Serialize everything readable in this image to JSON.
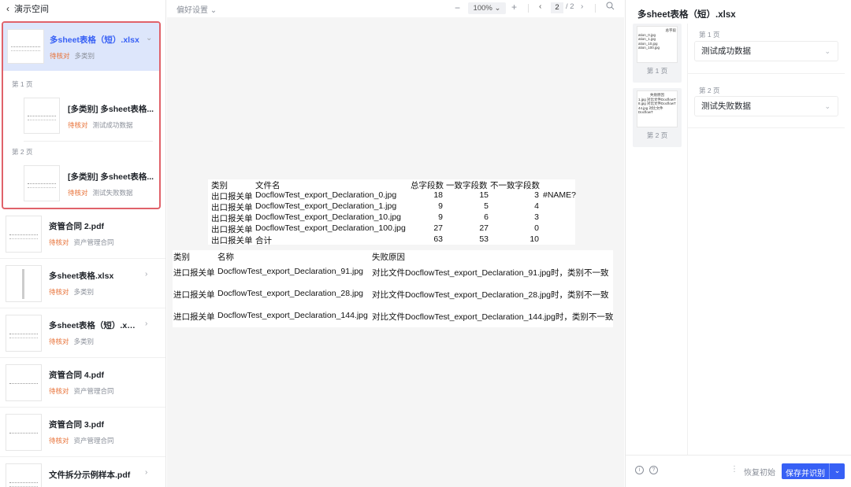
{
  "sidebar": {
    "header": {
      "back_icon": "chevron-left-icon",
      "title": "演示空间"
    },
    "selected": {
      "title": "多sheet表格（短）.xlsx",
      "status": "待核对",
      "category": "多类别",
      "pages": [
        {
          "label": "第 1 页",
          "title": "[多类别] 多sheet表格...",
          "status": "待核对",
          "category": "测试成功数据"
        },
        {
          "label": "第 2 页",
          "title": "[多类别] 多sheet表格...",
          "status": "待核对",
          "category": "测试失败数据"
        }
      ]
    },
    "items": [
      {
        "title": "资管合同 2.pdf",
        "status": "待核对",
        "category": "资产管理合同"
      },
      {
        "title": "多sheet表格.xlsx",
        "status": "待核对",
        "category": "多类别"
      },
      {
        "title": "多sheet表格（短）.xlsx",
        "status": "待核对",
        "category": "多类别"
      },
      {
        "title": "资管合同 4.pdf",
        "status": "待核对",
        "category": "资产管理合同"
      },
      {
        "title": "资管合同 3.pdf",
        "status": "待核对",
        "category": "资产管理合同"
      },
      {
        "title": "文件拆分示例样本.pdf",
        "status": "",
        "category": ""
      }
    ]
  },
  "toolbar": {
    "preferences": "偏好设置 ⌄",
    "zoom_out": "−",
    "zoom": "100% ⌄",
    "zoom_in": "+",
    "prev": "‹",
    "current_page": "2",
    "total_pages": "/ 2",
    "next": "›",
    "search_icon": "search-icon"
  },
  "sheet1": {
    "headers": [
      "类别",
      "文件名",
      "总字段数",
      "一致字段数",
      "不一致字段数"
    ],
    "rows": [
      [
        "出口报关单",
        "DocflowTest_export_Declaration_0.jpg",
        "18",
        "15",
        "3",
        "#NAME?"
      ],
      [
        "出口报关单",
        "DocflowTest_export_Declaration_1.jpg",
        "9",
        "5",
        "4",
        ""
      ],
      [
        "出口报关单",
        "DocflowTest_export_Declaration_10.jpg",
        "9",
        "6",
        "3",
        ""
      ],
      [
        "出口报关单",
        "DocflowTest_export_Declaration_100.jpg",
        "27",
        "27",
        "0",
        ""
      ],
      [
        "出口报关单",
        "合计",
        "63",
        "53",
        "10",
        ""
      ]
    ]
  },
  "sheet2": {
    "headers": [
      "类别",
      "名称",
      "失败原因"
    ],
    "rows": [
      [
        "进口报关单",
        "DocflowTest_export_Declaration_91.jpg",
        "对比文件DocflowTest_export_Declaration_91.jpg时，类别不一致"
      ],
      [
        "进口报关单",
        "DocflowTest_export_Declaration_28.jpg",
        "对比文件DocflowTest_export_Declaration_28.jpg时，类别不一致"
      ],
      [
        "进口报关单",
        "DocflowTest_export_Declaration_144.jpg",
        "对比文件DocflowTest_export_Declaration_144.jpg时，类别不一致"
      ]
    ]
  },
  "right": {
    "title": "多sheet表格（短）.xlsx",
    "thumbs": [
      {
        "label": "第 1 页",
        "lines": [
          "总字段",
          "ation_0.jpg",
          "ation_1.jpg",
          "ation_10.jpg",
          "ation_100.jpg"
        ]
      },
      {
        "label": "第 2 页",
        "lines": [
          "失败原因",
          "1.jpg 对比文件DocflowT",
          "8.jpg 对比文件DocflowT",
          "44.jpg 对比文件DocflowT"
        ]
      }
    ],
    "sections": [
      {
        "label": "第 1 页",
        "value": "测试成功数据"
      },
      {
        "label": "第 2 页",
        "value": "测试失败数据"
      }
    ],
    "footer": {
      "info_icon": "info-icon",
      "help_icon": "help-icon",
      "more": "⋮",
      "reset": "恢复初始",
      "save": "保存并识别",
      "save_dropdown": "⌄"
    }
  },
  "colors": {
    "accent": "#3760f5",
    "selected_bg": "#dde6fb",
    "highlight_border": "#e0626a",
    "status": "#e8733a"
  }
}
